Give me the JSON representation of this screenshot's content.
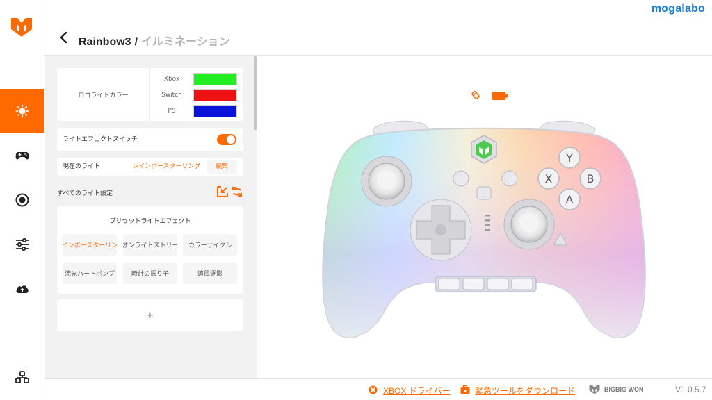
{
  "brand": {
    "name": "mogalabo"
  },
  "header": {
    "title": "Rainbow3",
    "separator": "/",
    "subtitle": "イルミネーション"
  },
  "sidebar": {
    "items": [
      {
        "icon": "light-icon",
        "active": true
      },
      {
        "icon": "gamepad-icon",
        "active": false
      },
      {
        "icon": "record-icon",
        "active": false
      },
      {
        "icon": "sliders-icon",
        "active": false
      },
      {
        "icon": "cloud-upload-icon",
        "active": false
      },
      {
        "icon": "controller-settings-icon",
        "active": false
      }
    ]
  },
  "settings": {
    "logo_color": {
      "label": "ロゴライトカラー",
      "platforms": [
        {
          "name": "Xbox",
          "color": "#22ee22"
        },
        {
          "name": "Switch",
          "color": "#ee1111"
        },
        {
          "name": "PS",
          "color": "#0a14d8"
        }
      ]
    },
    "light_switch": {
      "label": "ライトエフェクトスイッチ",
      "on": true
    },
    "current_light": {
      "label": "現在のライト",
      "value": "レインボースターリング",
      "edit": "編集"
    },
    "all_lights": {
      "label": "すべてのライト設定",
      "import_icon": "import-icon",
      "refresh_icon": "refresh-icon"
    },
    "presets": {
      "title": "プリセットライトエフェクト",
      "items": [
        {
          "label": "レインボースターリング",
          "active": true
        },
        {
          "label": "ネオンライトストリーム",
          "active": false
        },
        {
          "label": "カラーサイクル",
          "active": false
        },
        {
          "label": "流光ハートポンプ",
          "active": false
        },
        {
          "label": "時計の振り子",
          "active": false
        },
        {
          "label": "追風逐影",
          "active": false
        }
      ]
    },
    "add_label": "+"
  },
  "controller": {
    "buttons": {
      "y": "Y",
      "x": "X",
      "b": "B",
      "a": "A"
    },
    "status": {
      "connection_icon": "usb-connection-icon",
      "battery_icon": "battery-icon"
    }
  },
  "footer": {
    "xbox_driver": "XBOX ドライバー",
    "emergency_tool": "緊急ツールをダウンロード",
    "company": "BIGBIG WON",
    "version": "V1.0.5.7"
  },
  "colors": {
    "accent": "#ff6a00",
    "brand": "#1e7fd6"
  }
}
